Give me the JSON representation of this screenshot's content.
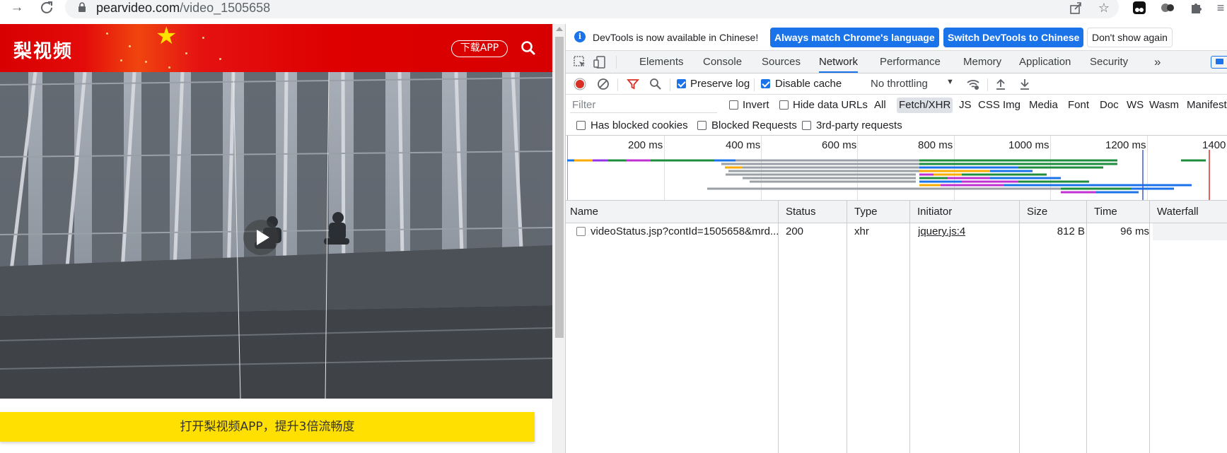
{
  "browser": {
    "url_host": "pearvideo.com",
    "url_path": "/video_1505658"
  },
  "page": {
    "logo": "梨视频",
    "download_app_label": "下载APP",
    "cta_label": "打开梨视频APP，提升3倍流畅度"
  },
  "devtools": {
    "infobar": {
      "message": "DevTools is now available in Chinese!",
      "btn_match": "Always match Chrome's language",
      "btn_switch": "Switch DevTools to Chinese",
      "btn_dismiss": "Don't show again"
    },
    "tabs": [
      "Elements",
      "Console",
      "Sources",
      "Network",
      "Performance",
      "Memory",
      "Application",
      "Security"
    ],
    "active_tab": "Network",
    "more_tabs": "»",
    "toolbar": {
      "preserve_log": "Preserve log",
      "disable_cache": "Disable cache",
      "throttling": "No throttling"
    },
    "filter": {
      "placeholder": "Filter",
      "invert": "Invert",
      "hide_data_urls": "Hide data URLs",
      "types": [
        "All",
        "Fetch/XHR",
        "JS",
        "CSS",
        "Img",
        "Media",
        "Font",
        "Doc",
        "WS",
        "Wasm",
        "Manifest"
      ],
      "active_type": "Fetch/XHR"
    },
    "blocked": {
      "has_blocked_cookies": "Has blocked cookies",
      "blocked_requests": "Blocked Requests",
      "third_party": "3rd-party requests"
    },
    "overview_ticks": [
      "200 ms",
      "400 ms",
      "600 ms",
      "800 ms",
      "1000 ms",
      "1200 ms",
      "1400"
    ],
    "columns": [
      "Name",
      "Status",
      "Type",
      "Initiator",
      "Size",
      "Time",
      "Waterfall"
    ],
    "rows": [
      {
        "name": "videoStatus.jsp?contId=1505658&mrd...",
        "status": "200",
        "type": "xhr",
        "initiator": "jquery.js:4",
        "size": "812 B",
        "time": "96 ms"
      }
    ]
  },
  "colors": {
    "accent": "#1a73e8",
    "site_red": "#d80000",
    "cta_yellow": "#ffe000",
    "record_red": "#d93025"
  }
}
